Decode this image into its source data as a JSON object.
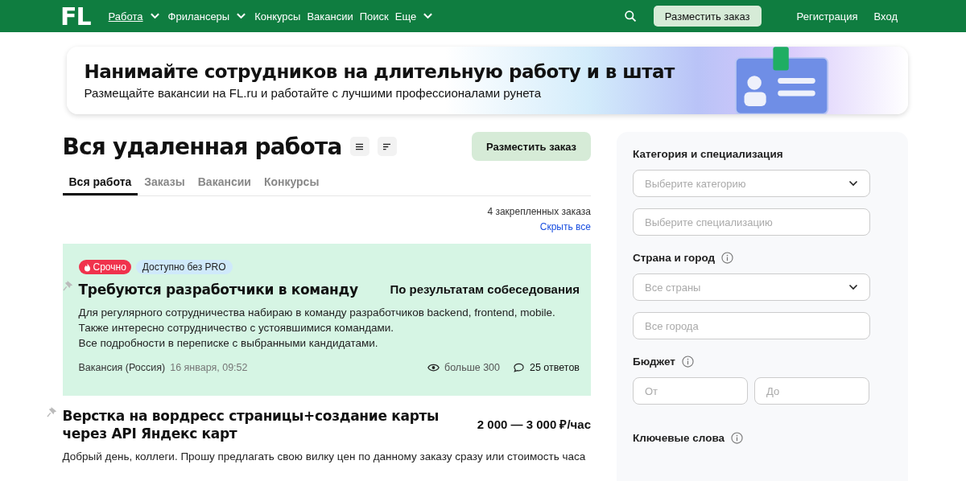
{
  "nav": {
    "logo": "FL",
    "items": [
      {
        "label": "Работа",
        "selected": true,
        "dropdown": true
      },
      {
        "label": "Фрилансеры",
        "selected": false,
        "dropdown": true
      },
      {
        "label": "Конкурсы",
        "selected": false,
        "dropdown": false
      },
      {
        "label": "Вакансии",
        "selected": false,
        "dropdown": false
      },
      {
        "label": "Поиск",
        "selected": false,
        "dropdown": false
      },
      {
        "label": "Еще",
        "selected": false,
        "dropdown": true
      }
    ],
    "post_button": "Разместить заказ",
    "links": [
      "Регистрация",
      "Вход"
    ]
  },
  "banner": {
    "title": "Нанимайте сотрудников на длительную работу и в штат",
    "subtitle": "Размещайте вакансии на FL.ru и работайте с лучшими профессионалами рунета"
  },
  "page_title": "Вся удаленная работа",
  "post_button": "Разместить заказ",
  "tabs": [
    {
      "label": "Вся работа",
      "selected": true
    },
    {
      "label": "Заказы",
      "selected": false
    },
    {
      "label": "Вакансии",
      "selected": false
    },
    {
      "label": "Конкурсы",
      "selected": false
    }
  ],
  "pinned_count": "4 закрепленных заказа",
  "hide_all": "Скрыть все",
  "jobs": [
    {
      "highlighted": true,
      "pinned": true,
      "badges": [
        {
          "kind": "urgent",
          "label": "Срочно"
        },
        {
          "kind": "info",
          "label": "Доступно без PRO"
        }
      ],
      "title": "Требуются разработчики в команду",
      "price": "По результатам собеседования",
      "description": [
        "Для регулярного сотрудничества набираю в команду разработчиков backend, frontend, mobile.",
        "Также интересно сотрудничество с устоявшимися командами.",
        "Все подробности в переписке с выбранными кандидатами."
      ],
      "category": "Вакансия (Россия)",
      "date": "16 января, 09:52",
      "views": "больше 300",
      "responses": "25 ответов"
    },
    {
      "highlighted": false,
      "pinned": true,
      "title": "Верстка на вордресс страницы+создание карты через API Яндекс карт",
      "price": "2 000 — 3 000 ₽/час",
      "description": [
        "Добрый день, коллеги. Прошу предлагать свою вилку цен по данному заказу сразу или стоимость часа"
      ]
    }
  ],
  "filters": [
    {
      "label": "Категория и специализация",
      "info": false,
      "fields": [
        {
          "kind": "select",
          "placeholder": "Выберите категорию"
        },
        {
          "kind": "text",
          "placeholder": "Выберите специализацию"
        }
      ]
    },
    {
      "label": "Страна и город",
      "info": true,
      "fields": [
        {
          "kind": "select",
          "placeholder": "Все страны"
        },
        {
          "kind": "text",
          "placeholder": "Все города"
        }
      ]
    },
    {
      "label": "Бюджет",
      "info": true,
      "fields": [
        {
          "kind": "pair",
          "placeholder": "От",
          "placeholder2": "До"
        }
      ]
    },
    {
      "label": "Ключевые слова",
      "info": true
    }
  ]
}
